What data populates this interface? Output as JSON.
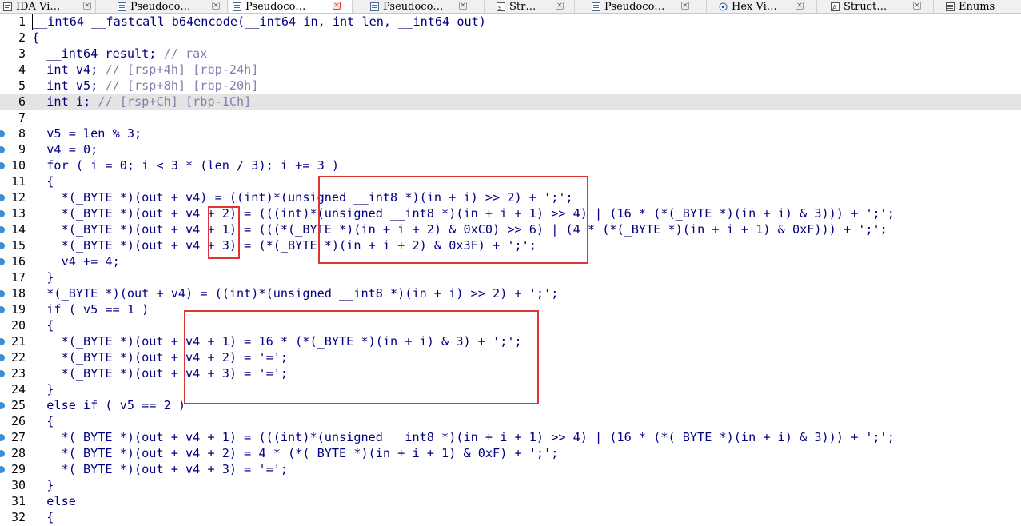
{
  "tabs": [
    {
      "label": "IDA Vi…",
      "icon": "ida-view-icon"
    },
    {
      "label": "Pseudoco…",
      "icon": "pseudocode-icon"
    },
    {
      "label": "Pseudoco…",
      "icon": "pseudocode-icon",
      "active": true
    },
    {
      "label": "Pseudoco…",
      "icon": "pseudocode-icon"
    },
    {
      "label": "Str…",
      "icon": "strings-icon"
    },
    {
      "label": "Pseudoco…",
      "icon": "pseudocode-icon"
    },
    {
      "label": "Hex Vi…",
      "icon": "hex-view-icon"
    },
    {
      "label": "Struct…",
      "icon": "structures-icon"
    },
    {
      "label": "Enums",
      "icon": "enums-icon"
    }
  ],
  "code_lines": [
    {
      "num": "1",
      "text": "__int64 __fastcall b64encode(__int64 in, int len, __int64 out)"
    },
    {
      "num": "2",
      "text": "{"
    },
    {
      "num": "3",
      "text": "  __int64 result; // rax"
    },
    {
      "num": "4",
      "text": "  int v4; // [rsp+4h] [rbp-24h]"
    },
    {
      "num": "5",
      "text": "  int v5; // [rsp+8h] [rbp-20h]"
    },
    {
      "num": "6",
      "text": "  int i; // [rsp+Ch] [rbp-1Ch]"
    },
    {
      "num": "7",
      "text": ""
    },
    {
      "num": "8",
      "text": "  v5 = len % 3;"
    },
    {
      "num": "9",
      "text": "  v4 = 0;"
    },
    {
      "num": "10",
      "text": "  for ( i = 0; i < 3 * (len / 3); i += 3 )"
    },
    {
      "num": "11",
      "text": "  {"
    },
    {
      "num": "12",
      "text": "    *(_BYTE *)(out + v4) = ((int)*(unsigned __int8 *)(in + i) >> 2) + ';';"
    },
    {
      "num": "13",
      "text": "    *(_BYTE *)(out + v4 + 2) = (((int)*(unsigned __int8 *)(in + i + 1) >> 4) | (16 * (*(_BYTE *)(in + i) & 3))) + ';';"
    },
    {
      "num": "14",
      "text": "    *(_BYTE *)(out + v4 + 1) = (((*(_BYTE *)(in + i + 2) & 0xC0) >> 6) | (4 * (*(_BYTE *)(in + i + 1) & 0xF))) + ';';"
    },
    {
      "num": "15",
      "text": "    *(_BYTE *)(out + v4 + 3) = (*(_BYTE *)(in + i + 2) & 0x3F) + ';';"
    },
    {
      "num": "16",
      "text": "    v4 += 4;"
    },
    {
      "num": "17",
      "text": "  }"
    },
    {
      "num": "18",
      "text": "  *(_BYTE *)(out + v4) = ((int)*(unsigned __int8 *)(in + i) >> 2) + ';';"
    },
    {
      "num": "19",
      "text": "  if ( v5 == 1 )"
    },
    {
      "num": "20",
      "text": "  {"
    },
    {
      "num": "21",
      "text": "    *(_BYTE *)(out + v4 + 1) = 16 * (*(_BYTE *)(in + i) & 3) + ';';"
    },
    {
      "num": "22",
      "text": "    *(_BYTE *)(out + v4 + 2) = '=';"
    },
    {
      "num": "23",
      "text": "    *(_BYTE *)(out + v4 + 3) = '=';"
    },
    {
      "num": "24",
      "text": "  }"
    },
    {
      "num": "25",
      "text": "  else if ( v5 == 2 )"
    },
    {
      "num": "26",
      "text": "  {"
    },
    {
      "num": "27",
      "text": "    *(_BYTE *)(out + v4 + 1) = (((int)*(unsigned __int8 *)(in + i + 1) >> 4) | (16 * (*(_BYTE *)(in + i) & 3))) + ';';"
    },
    {
      "num": "28",
      "text": "    *(_BYTE *)(out + v4 + 2) = 4 * (*(_BYTE *)(in + i + 1) & 0xF) + ';';"
    },
    {
      "num": "29",
      "text": "    *(_BYTE *)(out + v4 + 3) = '=';"
    },
    {
      "num": "30",
      "text": "  }"
    },
    {
      "num": "31",
      "text": "  else"
    },
    {
      "num": "32",
      "text": "  {"
    }
  ],
  "highlighted_line": "6",
  "breakpoint_lines": [
    "8",
    "9",
    "10",
    "12",
    "13",
    "14",
    "15",
    "16",
    "18",
    "19",
    "21",
    "22",
    "23",
    "25",
    "27",
    "28",
    "29"
  ],
  "colors": {
    "code_text": "#000080",
    "comment": "#7f7faf",
    "line_highlight": "#e4e4e4",
    "annotation_box": "#e03434",
    "breakpoint_marker": "#3c8fd6"
  }
}
